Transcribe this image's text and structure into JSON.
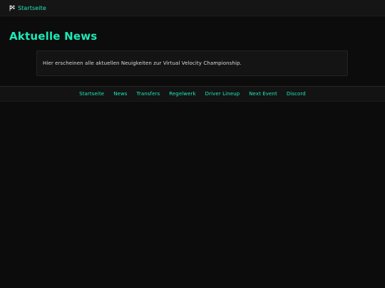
{
  "topbar": {
    "home_label": "Startseite"
  },
  "page": {
    "title": "Aktuelle News",
    "intro": "Hier erscheinen alle aktuellen Neuigkeiten zur Virtual Velocity Championship."
  },
  "nav": {
    "items": [
      {
        "label": "Startseite"
      },
      {
        "label": "News"
      },
      {
        "label": "Transfers"
      },
      {
        "label": "Regelwerk"
      },
      {
        "label": "Driver Lineup"
      },
      {
        "label": "Next Event"
      },
      {
        "label": "Discord"
      }
    ]
  },
  "colors": {
    "accent": "#1de9b6",
    "background": "#0c0c0c",
    "card": "#141414"
  },
  "icons": {
    "home": "checkered-flag-icon"
  }
}
